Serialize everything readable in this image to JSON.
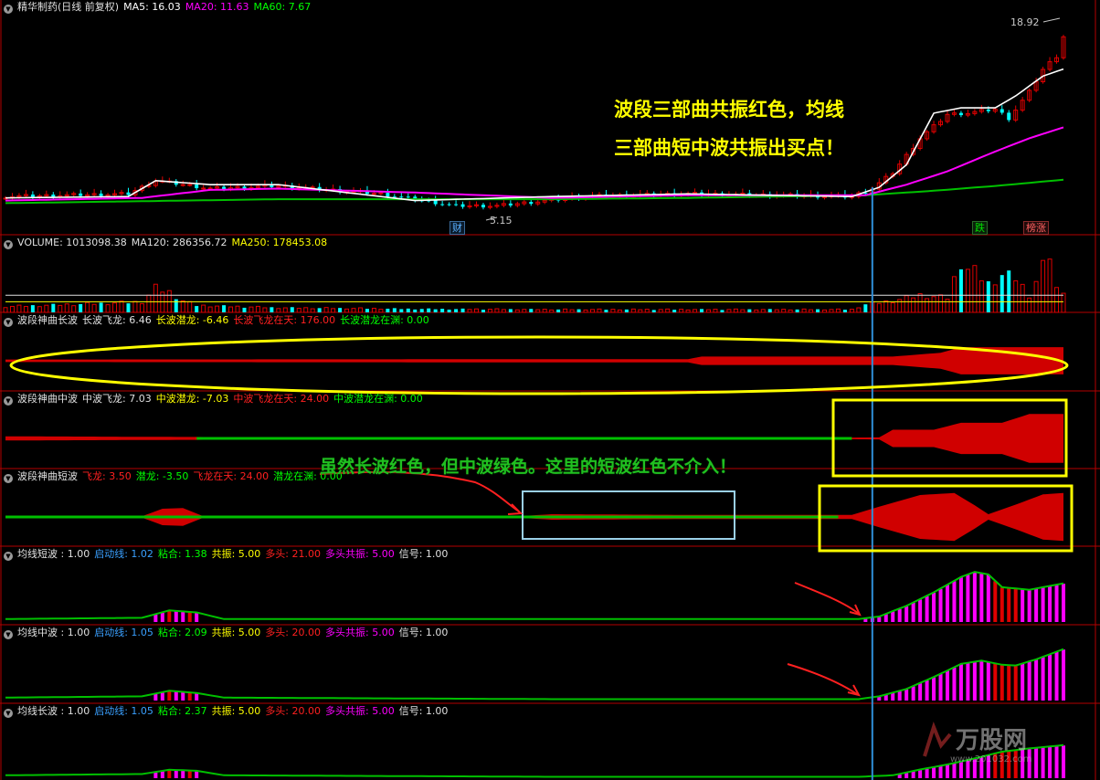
{
  "colors": {
    "bg": "#000000",
    "panel_border": "#b30000",
    "red": "#e00000",
    "green": "#00c000",
    "white": "#ffffff",
    "magenta": "#ff00ff",
    "yellow": "#ffff00",
    "cyan": "#00ffff",
    "vline": "#2f8fd8",
    "gray": "#c8c8c8",
    "annot_red": "#ff2020"
  },
  "panels": {
    "price": {
      "collapse_icon": "chevron-down-icon",
      "title": "精华制药(日线 前复权)",
      "ma5_label": "MA5: 16.03",
      "ma20_label": "MA20: 11.63",
      "ma60_label": "MA60: 7.67",
      "high_label": "18.92",
      "low_label": "5.15",
      "badge_cai": "财",
      "badge_die": "跌",
      "badge_zhang": "榜涨"
    },
    "volume": {
      "title": "VOLUME: 1013098.38",
      "ma120_label": "MA120: 286356.72",
      "ma250_label": "MA250: 178453.08"
    },
    "long_wave": {
      "title": "波段神曲长波",
      "fly_label": "长波飞龙: 6.46",
      "hide_label": "长波潜龙: -6.46",
      "fly_sky_label": "长波飞龙在天: 176.00",
      "hide_abyss_label": "长波潜龙在渊: 0.00"
    },
    "mid_wave": {
      "title": "波段神曲中波",
      "fly_label": "中波飞龙: 7.03",
      "hide_label": "中波潜龙: -7.03",
      "fly_sky_label": "中波飞龙在天: 24.00",
      "hide_abyss_label": "中波潜龙在渊: 0.00"
    },
    "short_wave": {
      "title": "波段神曲短波",
      "fly_label": "飞龙: 3.50",
      "hide_label": "潜龙: -3.50",
      "fly_sky_label": "飞龙在天: 24.00",
      "hide_abyss_label": "潜龙在渊: 0.00"
    },
    "ma_short": {
      "title": "均线短波 : 1.00",
      "start_label": "启动线: 1.02",
      "stick_label": "粘合: 1.38",
      "resonance_label": "共振: 5.00",
      "bull_label": "多头: 21.00",
      "bull_res_label": "多头共振: 5.00",
      "signal_label": "信号: 1.00"
    },
    "ma_mid": {
      "title": "均线中波 : 1.00",
      "start_label": "启动线: 1.05",
      "stick_label": "粘合: 2.09",
      "resonance_label": "共振: 5.00",
      "bull_label": "多头: 20.00",
      "bull_res_label": "多头共振: 5.00",
      "signal_label": "信号: 1.00"
    },
    "ma_long": {
      "title": "均线长波 : 1.00",
      "start_label": "启动线: 1.05",
      "stick_label": "粘合: 2.37",
      "resonance_label": "共振: 5.00",
      "bull_label": "多头: 20.00",
      "bull_res_label": "多头共振: 5.00",
      "signal_label": "信号: 1.00"
    }
  },
  "annotations": {
    "line1": "波段三部曲共振红色，均线",
    "line2": "三部曲短中波共振出买点！",
    "mid_note": "虽然长波红色，但中波绿色。这里的短波红色不介入！"
  },
  "watermark": {
    "text": "万股网",
    "url_text": "www.201032.com"
  },
  "chart_data": [
    {
      "type": "candlestick",
      "title": "精华制药(日线 前复权)",
      "x_count": 156,
      "ylim": [
        4,
        20
      ],
      "price_high": 18.92,
      "price_low": 5.15,
      "ma5_last": 16.03,
      "ma20_last": 11.63,
      "ma60_last": 7.67,
      "ma5_key": [
        [
          0,
          6.3
        ],
        [
          18,
          6.4
        ],
        [
          22,
          7.6
        ],
        [
          30,
          7.3
        ],
        [
          40,
          7.3
        ],
        [
          60,
          6.1
        ],
        [
          80,
          6.4
        ],
        [
          100,
          6.6
        ],
        [
          124,
          6.4
        ],
        [
          128,
          7.1
        ],
        [
          132,
          8.8
        ],
        [
          136,
          12.7
        ],
        [
          140,
          13.1
        ],
        [
          145,
          13.1
        ],
        [
          148,
          14.0
        ],
        [
          152,
          15.5
        ],
        [
          155,
          16.03
        ]
      ],
      "ma20_key": [
        [
          0,
          6.1
        ],
        [
          20,
          6.3
        ],
        [
          30,
          6.9
        ],
        [
          40,
          7.0
        ],
        [
          60,
          6.7
        ],
        [
          80,
          6.3
        ],
        [
          100,
          6.5
        ],
        [
          126,
          6.5
        ],
        [
          132,
          7.3
        ],
        [
          138,
          8.3
        ],
        [
          145,
          9.8
        ],
        [
          150,
          10.8
        ],
        [
          155,
          11.63
        ]
      ],
      "ma60_key": [
        [
          0,
          5.9
        ],
        [
          40,
          6.2
        ],
        [
          80,
          6.2
        ],
        [
          100,
          6.3
        ],
        [
          126,
          6.5
        ],
        [
          135,
          6.8
        ],
        [
          145,
          7.2
        ],
        [
          155,
          7.67
        ]
      ],
      "close_key": [
        [
          0,
          6.4
        ],
        [
          18,
          6.6
        ],
        [
          22,
          7.6
        ],
        [
          26,
          7.3
        ],
        [
          30,
          7.0
        ],
        [
          40,
          7.2
        ],
        [
          55,
          6.6
        ],
        [
          66,
          5.7
        ],
        [
          72,
          5.7
        ],
        [
          85,
          6.4
        ],
        [
          100,
          6.6
        ],
        [
          124,
          6.4
        ],
        [
          127,
          7.0
        ],
        [
          130,
          8.2
        ],
        [
          134,
          10.8
        ],
        [
          138,
          12.6
        ],
        [
          141,
          12.7
        ],
        [
          145,
          13.0
        ],
        [
          147,
          12.3
        ],
        [
          150,
          14.3
        ],
        [
          152,
          16.0
        ],
        [
          154,
          17.0
        ],
        [
          155,
          18.5
        ]
      ]
    },
    {
      "type": "bar",
      "title": "VOLUME",
      "x_count": 156,
      "last_volume": 1013098.38,
      "ma120": 286356.72,
      "ma250": 178453.08,
      "ylim": [
        0,
        1100000
      ],
      "volume_key": [
        [
          0,
          100000
        ],
        [
          20,
          180000
        ],
        [
          22,
          420000
        ],
        [
          24,
          350000
        ],
        [
          26,
          200000
        ],
        [
          28,
          120000
        ],
        [
          40,
          80000
        ],
        [
          60,
          60000
        ],
        [
          80,
          50000
        ],
        [
          100,
          50000
        ],
        [
          124,
          50000
        ],
        [
          126,
          140000
        ],
        [
          130,
          200000
        ],
        [
          134,
          300000
        ],
        [
          138,
          250000
        ],
        [
          140,
          900000
        ],
        [
          141,
          750000
        ],
        [
          142,
          700000
        ],
        [
          144,
          500000
        ],
        [
          146,
          650000
        ],
        [
          148,
          600000
        ],
        [
          150,
          300000
        ],
        [
          153,
          1013098
        ],
        [
          154,
          400000
        ]
      ]
    },
    {
      "type": "area",
      "title": "波段神曲长波",
      "series": [
        {
          "name": "长波飞龙",
          "values_key": [
            [
              0,
              0.6
            ],
            [
              100,
              0.8
            ],
            [
              102,
              2.0
            ],
            [
              130,
              2.0
            ],
            [
              137,
              3.8
            ],
            [
              140,
              6.46
            ],
            [
              155,
              6.46
            ]
          ]
        }
      ],
      "fly_in_sky": 176.0,
      "hide_in_abyss": 0.0,
      "ylim": [
        -7,
        7
      ]
    },
    {
      "type": "area",
      "title": "波段神曲中波",
      "series": [
        {
          "name": "中波飞龙",
          "values_key": [
            [
              0,
              0.6
            ],
            [
              60,
              0.2
            ],
            [
              120,
              0.2
            ],
            [
              128,
              0.3
            ],
            [
              130,
              2.5
            ],
            [
              136,
              2.5
            ],
            [
              140,
              4.5
            ],
            [
              146,
              4.5
            ],
            [
              150,
              7.03
            ],
            [
              155,
              7.03
            ]
          ]
        }
      ],
      "fly_in_sky": 24.0,
      "hide_in_abyss": 0.0,
      "ylim": [
        -8,
        8
      ]
    },
    {
      "type": "area",
      "title": "波段神曲短波",
      "series": [
        {
          "name": "飞龙",
          "values_key": [
            [
              0,
              0.1
            ],
            [
              20,
              0.1
            ],
            [
              23,
              1.2
            ],
            [
              26,
              1.3
            ],
            [
              29,
              0.1
            ],
            [
              75,
              0.1
            ],
            [
              80,
              0.4
            ],
            [
              100,
              0.3
            ],
            [
              124,
              0.3
            ],
            [
              128,
              1.5
            ],
            [
              134,
              3.2
            ],
            [
              139,
              3.5
            ],
            [
              142,
              1.7
            ],
            [
              144,
              0.4
            ],
            [
              148,
              1.8
            ],
            [
              152,
              3.3
            ],
            [
              155,
              3.5
            ]
          ]
        }
      ],
      "fly_in_sky": 24.0,
      "hide_in_abyss": 0.0,
      "ylim": [
        -4,
        4
      ]
    },
    {
      "type": "bar",
      "title": "均线短波",
      "start_line": 1.02,
      "stick": 1.38,
      "resonance": 5.0,
      "bull": 21.0,
      "bull_resonance": 5.0,
      "signal": 1.0,
      "ylim": [
        0,
        24
      ],
      "values_key": [
        [
          0,
          1.0
        ],
        [
          20,
          1.5
        ],
        [
          24,
          4.4
        ],
        [
          28,
          3.6
        ],
        [
          32,
          1.0
        ],
        [
          80,
          1.0
        ],
        [
          125,
          1.0
        ],
        [
          128,
          2.0
        ],
        [
          132,
          6.2
        ],
        [
          136,
          11.5
        ],
        [
          140,
          17.5
        ],
        [
          142,
          19.5
        ],
        [
          144,
          18.5
        ],
        [
          146,
          13.5
        ],
        [
          148,
          13.0
        ],
        [
          150,
          12.5
        ],
        [
          155,
          15.0
        ]
      ]
    },
    {
      "type": "bar",
      "title": "均线中波",
      "start_line": 1.05,
      "stick": 2.09,
      "resonance": 5.0,
      "bull": 20.0,
      "bull_resonance": 5.0,
      "signal": 1.0,
      "ylim": [
        0,
        24
      ],
      "values_key": [
        [
          0,
          1.0
        ],
        [
          20,
          1.5
        ],
        [
          24,
          3.7
        ],
        [
          28,
          2.8
        ],
        [
          32,
          1.0
        ],
        [
          80,
          0.4
        ],
        [
          125,
          0.4
        ],
        [
          128,
          1.5
        ],
        [
          132,
          4.4
        ],
        [
          136,
          9.1
        ],
        [
          140,
          14.2
        ],
        [
          143,
          15.5
        ],
        [
          146,
          13.9
        ],
        [
          148,
          13.6
        ],
        [
          151,
          16.0
        ],
        [
          155,
          20.0
        ]
      ]
    },
    {
      "type": "bar",
      "title": "均线长波",
      "start_line": 1.05,
      "stick": 2.37,
      "resonance": 5.0,
      "bull": 20.0,
      "bull_resonance": 5.0,
      "signal": 1.0,
      "ylim": [
        0,
        24
      ],
      "values_key": [
        [
          0,
          1.0
        ],
        [
          20,
          1.5
        ],
        [
          24,
          3.2
        ],
        [
          28,
          2.8
        ],
        [
          32,
          1.0
        ],
        [
          80,
          0.4
        ],
        [
          125,
          0.4
        ],
        [
          130,
          1.0
        ],
        [
          134,
          3.3
        ],
        [
          138,
          5.3
        ],
        [
          142,
          7.7
        ],
        [
          146,
          10.4
        ],
        [
          150,
          11.7
        ],
        [
          155,
          13.0
        ]
      ]
    }
  ]
}
